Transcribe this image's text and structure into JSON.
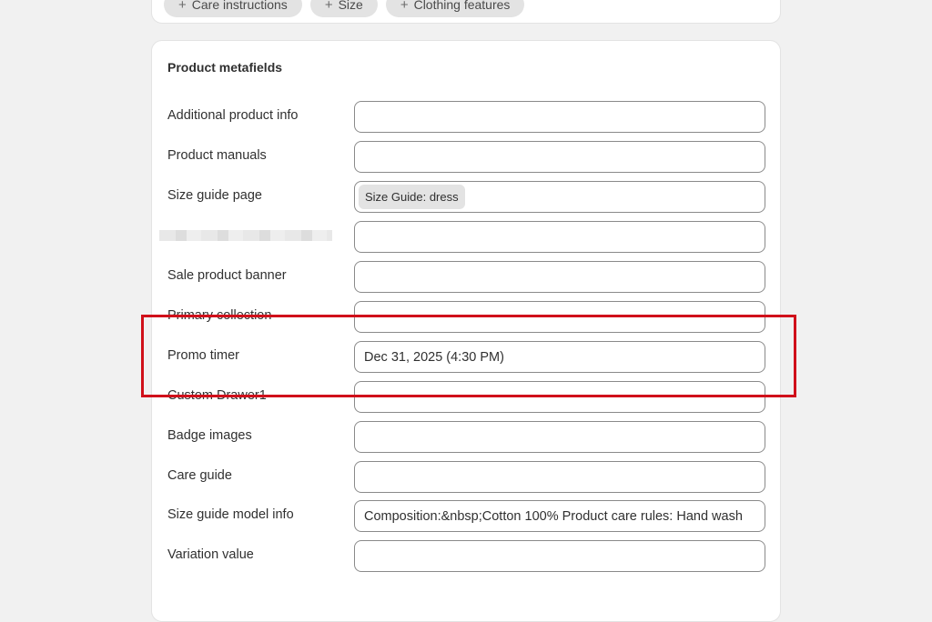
{
  "top_chips": [
    {
      "icon": "plus-icon",
      "label": "Care instructions"
    },
    {
      "icon": "plus-icon",
      "label": "Size"
    },
    {
      "icon": "plus-icon",
      "label": "Clothing features"
    }
  ],
  "card": {
    "title": "Product metafields",
    "rows": [
      {
        "label": "Additional product info",
        "value": ""
      },
      {
        "label": "Product manuals",
        "value": ""
      },
      {
        "label": "Size guide page",
        "value": "",
        "tag": "Size Guide: dress"
      },
      {
        "label": "",
        "value": ""
      },
      {
        "label": "Sale product banner",
        "value": ""
      },
      {
        "label": "Primary collection",
        "value": ""
      },
      {
        "label": "Promo timer",
        "value": "Dec 31, 2025 (4:30 PM)"
      },
      {
        "label": "Custom Drawer1",
        "value": ""
      },
      {
        "label": "Badge images",
        "value": ""
      },
      {
        "label": "Care guide",
        "value": ""
      },
      {
        "label": "Size guide model info",
        "value": "Composition:&nbsp;Cotton 100% Product care rules: Hand wash"
      },
      {
        "label": "Variation value",
        "value": ""
      }
    ]
  },
  "colors": {
    "highlight": "#d0101a",
    "background": "#f1f1f1"
  }
}
